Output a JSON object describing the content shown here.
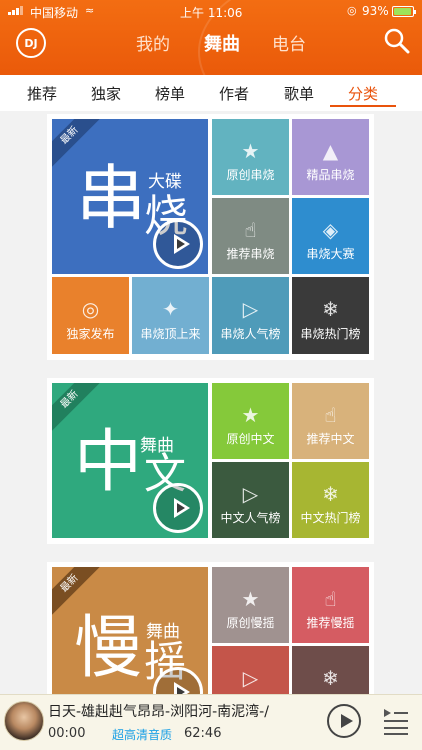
{
  "status_bar": {
    "carrier": "中国移动",
    "time": "上午 11:06",
    "battery": "93%"
  },
  "header": {
    "logo_text": "DJ",
    "tabs": [
      {
        "label": "我的"
      },
      {
        "label": "舞曲",
        "active": true
      },
      {
        "label": "电台"
      }
    ]
  },
  "category_tabs": [
    "推荐",
    "独家",
    "榜单",
    "作者",
    "歌单",
    "分类"
  ],
  "active_category": "分类",
  "sections": [
    {
      "ribbon": "最新",
      "big_char_1": "串",
      "big_char_2": "烧",
      "subtitle": "大碟",
      "color": "#3d6fbf",
      "ribbon_color": "#2a4f8d",
      "tiles": [
        {
          "label": "原创串烧",
          "icon": "star-icon",
          "color": "#62b3c0"
        },
        {
          "label": "精品串烧",
          "icon": "tree-icon",
          "color": "#a897d4"
        },
        {
          "label": "推荐串烧",
          "icon": "thumb-up-icon",
          "color": "#7f8b83"
        },
        {
          "label": "串烧大赛",
          "icon": "medal-icon",
          "color": "#2e8dcf"
        },
        {
          "label": "独家发布",
          "icon": "globe-icon",
          "color": "#e9812c"
        },
        {
          "label": "串烧顶上来",
          "icon": "pin-icon",
          "color": "#72afd1"
        },
        {
          "label": "串烧人气榜",
          "icon": "play-icon",
          "color": "#4f9bb9"
        },
        {
          "label": "串烧热门榜",
          "icon": "flame-icon",
          "color": "#3a3a3a"
        }
      ]
    },
    {
      "ribbon": "最新",
      "big_char_1": "中",
      "big_char_2": "文",
      "subtitle": "舞曲",
      "color": "#2fa97e",
      "ribbon_color": "#21805e",
      "tiles": [
        {
          "label": "原创中文",
          "icon": "star-icon",
          "color": "#85c93a"
        },
        {
          "label": "推荐中文",
          "icon": "thumb-up-icon",
          "color": "#d8b27b"
        },
        {
          "label": "中文人气榜",
          "icon": "play-icon",
          "color": "#3b5a3f"
        },
        {
          "label": "中文热门榜",
          "icon": "flame-icon",
          "color": "#a7b632"
        }
      ]
    },
    {
      "ribbon": "最新",
      "big_char_1": "慢",
      "big_char_2": "摇",
      "subtitle": "舞曲",
      "color": "#c98a46",
      "ribbon_color": "#7a4e22",
      "tiles": [
        {
          "label": "原创慢摇",
          "icon": "star-icon",
          "color": "#a09290"
        },
        {
          "label": "推荐慢摇",
          "icon": "thumb-up-icon",
          "color": "#d55c62"
        },
        {
          "label": "",
          "icon": "play-icon",
          "color": "#c4554a"
        },
        {
          "label": "",
          "icon": "flame-icon",
          "color": "#6e4d4a"
        }
      ]
    }
  ],
  "player": {
    "song_title": "日天-雄赳赳气昂昂-浏阳河-南泥湾-/",
    "current_time": "00:00",
    "quality": "超高清音质",
    "duration": "62:46"
  }
}
